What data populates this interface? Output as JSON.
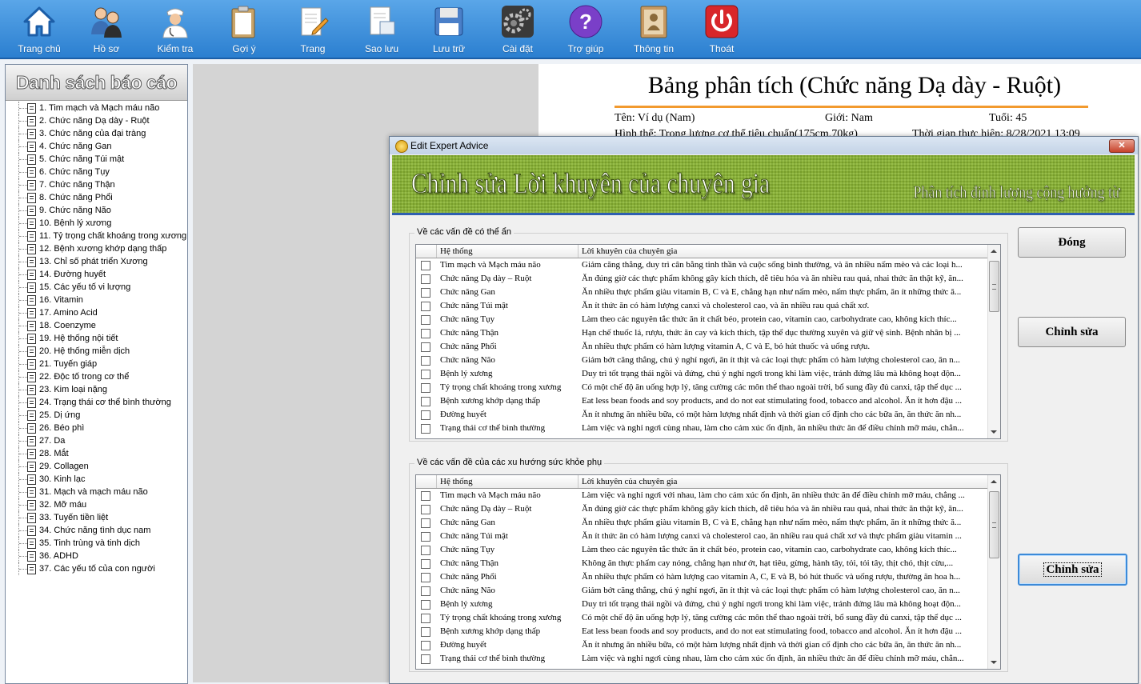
{
  "toolbar": {
    "items": [
      {
        "label": "Trang chủ",
        "icon": "home-icon"
      },
      {
        "label": "Hồ sơ",
        "icon": "users-icon"
      },
      {
        "label": "Kiểm tra",
        "icon": "doctor-icon"
      },
      {
        "label": "Gợi ý",
        "icon": "clipboard-icon"
      },
      {
        "label": "Trang",
        "icon": "page-edit-icon"
      },
      {
        "label": "Sao lưu",
        "icon": "backup-icon"
      },
      {
        "label": "Lưu trữ",
        "icon": "save-disk-icon"
      },
      {
        "label": "Cài đặt",
        "icon": "gear-icon"
      },
      {
        "label": "Trợ giúp",
        "icon": "help-icon"
      },
      {
        "label": "Thông tin",
        "icon": "info-book-icon"
      },
      {
        "label": "Thoát",
        "icon": "power-icon"
      }
    ]
  },
  "left_panel": {
    "title": "Danh sách báo cáo",
    "items": [
      "1. Tim mạch và Mạch máu não",
      "2. Chức năng Dạ dày - Ruột",
      "3. Chức năng của đại tràng",
      "4. Chức năng Gan",
      "5. Chức năng Túi mật",
      "6. Chức năng Tụy",
      "7. Chức năng Thận",
      "8. Chức năng Phổi",
      "9. Chức năng Não",
      "10. Bệnh lý xương",
      "11. Tỷ trọng chất khoáng trong xương",
      "12. Bệnh xương khớp dạng thấp",
      "13. Chỉ số phát triển Xương",
      "14. Đường huyết",
      "15. Các yếu tố vi lượng",
      "16. Vitamin",
      "17. Amino Acid",
      "18. Coenzyme",
      "19. Hệ thống nội tiết",
      "20. Hệ thống miễn dịch",
      "21. Tuyến giáp",
      "22. Độc tố trong cơ thể",
      "23. Kim loại nặng",
      "24. Trạng thái cơ thể bình thường",
      "25. Dị ứng",
      "26. Béo phì",
      "27. Da",
      "28. Mắt",
      "29. Collagen",
      "30. Kinh lạc",
      "31. Mạch và mạch máu não",
      "32. Mỡ máu",
      "33. Tuyến tiền liệt",
      "34. Chức năng tình dục nam",
      "35. Tinh trùng và tinh dịch",
      "36. ADHD",
      "37. Các yếu tố của con người"
    ]
  },
  "report": {
    "title": "Bảng phân tích (Chức năng Dạ dày - Ruột)",
    "name": "Tên: Ví dụ (Nam)",
    "gender": "Giới: Nam",
    "age": "Tuổi: 45",
    "physique": "Hình thể: Trọng lượng cơ thể tiêu chuẩn(175cm,70kg)",
    "time": "Thời gian thực hiện: 8/28/2021 13:09"
  },
  "dialog": {
    "title": "Edit Expert Advice",
    "close_label": "✕",
    "banner_title": "Chỉnh sửa Lời khuyên của chuyên gia",
    "banner_subtitle": "Phân tích định lượng cộng hưởng từ",
    "buttons": {
      "close": "Đóng",
      "edit1": "Chỉnh sửa",
      "edit2": "Chỉnh sửa"
    },
    "col_system": "Hệ thống",
    "col_advice": "Lời khuyên của chuyên gia",
    "group1": {
      "label": "Về các vấn đề có thể ẩn",
      "rows": [
        {
          "system": "Tim mạch và Mạch máu não",
          "advice": "Giảm căng thẳng, duy trì cân bằng tinh thần và cuộc sống bình thường, và ăn nhiều nấm mèo và các loại h..."
        },
        {
          "system": "Chức năng Dạ dày – Ruột",
          "advice": "Ăn đúng giờ các thực phẩm không gây kích thích, dễ tiêu hóa và ăn nhiều rau quả, nhai thức ăn thật kỹ, ăn..."
        },
        {
          "system": "Chức năng Gan",
          "advice": "Ăn nhiều thực phẩm giàu vitamin B, C và E, chẳng hạn như nấm mèo, nấm thực phẩm, ăn ít những thức ă..."
        },
        {
          "system": "Chức năng Túi mật",
          "advice": "Ăn ít thức ăn có hàm lượng canxi và cholesterol cao, và ăn nhiều rau quả chất xơ."
        },
        {
          "system": "Chức năng Tụy",
          "advice": "Làm theo các nguyên tắc thức ăn ít chất béo, protein cao, vitamin cao, carbohydrate cao, không kích thíc..."
        },
        {
          "system": "Chức năng Thận",
          "advice": "Hạn chế thuốc lá, rượu, thức ăn cay và kích thích, tập thể dục thường xuyên và giữ vệ sinh. Bệnh nhân bị ..."
        },
        {
          "system": "Chức năng Phổi",
          "advice": "Ăn nhiều thực phẩm có hàm lượng vitamin A, C và E, bỏ hút thuốc và uống rượu."
        },
        {
          "system": "Chức năng Não",
          "advice": "Giảm bớt căng thẳng, chú ý nghỉ ngơi, ăn ít thịt và các loại thực phẩm có hàm lượng cholesterol cao, ăn n..."
        },
        {
          "system": "Bệnh lý xương",
          "advice": "Duy trì tốt trạng thái ngồi và đứng, chú ý nghỉ ngơi trong khi làm việc, tránh đứng lâu mà không hoạt độn..."
        },
        {
          "system": "Tỷ trọng chất khoáng trong xương",
          "advice": "Có một chế độ ăn uống hợp lý, tăng cường các môn thể thao ngoài trời, bổ sung đầy đủ canxi, tập thể dục ..."
        },
        {
          "system": "Bệnh xương khớp dạng thấp",
          "advice": "Eat less bean foods and soy products, and do not eat stimulating food, tobacco and alcohol. Ăn ít hơn đậu ..."
        },
        {
          "system": "Đường huyết",
          "advice": "Ăn ít nhưng ăn nhiều bữa, có một hàm lượng nhất định và thời gian cố định cho các bữa ăn, ăn thức ăn nh..."
        },
        {
          "system": "Trạng thái cơ thể bình thường",
          "advice": "Làm việc và nghỉ ngơi cùng nhau, làm cho cảm xúc ổn định, ăn nhiều thức ăn để điều chỉnh mỡ máu, chẳn..."
        }
      ]
    },
    "group2": {
      "label": "Về các vấn đề của các xu hướng sức khỏe phụ",
      "rows": [
        {
          "system": "Tim mạch và Mạch máu não",
          "advice": "Làm việc và nghỉ ngơi với nhau, làm cho cảm xúc ổn định, ăn nhiều thức ăn để điều chỉnh mỡ máu, chẳng ..."
        },
        {
          "system": "Chức năng Dạ dày – Ruột",
          "advice": "Ăn đúng giờ các thực phẩm không gây kích thích, dễ tiêu hóa và ăn nhiều rau quả, nhai thức ăn thật kỹ, ăn..."
        },
        {
          "system": "Chức năng Gan",
          "advice": "Ăn nhiều thực phẩm giàu vitamin B, C và E, chẳng hạn như nấm mèo, nấm thực phẩm, ăn ít những thức ă..."
        },
        {
          "system": "Chức năng Túi mật",
          "advice": "Ăn ít thức ăn có hàm lượng canxi và cholesterol cao, ăn nhiều rau quả chất xơ và thực phẩm giàu vitamin ..."
        },
        {
          "system": "Chức năng Tụy",
          "advice": "Làm theo các nguyên tắc thức ăn ít chất béo, protein cao, vitamin cao, carbohydrate cao, không kích thíc..."
        },
        {
          "system": "Chức năng Thận",
          "advice": "Không ăn thực phẩm cay nóng, chẳng hạn như ớt, hạt tiêu, gừng, hành tây, tỏi, tỏi tây, thịt chó, thịt cừu,..."
        },
        {
          "system": "Chức năng Phổi",
          "advice": "Ăn nhiều thực phẩm có hàm lượng cao vitamin A, C, E và B, bỏ hút thuốc và uống rượu, thường ăn hoa h..."
        },
        {
          "system": "Chức năng Não",
          "advice": "Giảm bớt căng thẳng, chú ý nghỉ ngơi, ăn ít thịt và các loại thực phẩm có hàm lượng cholesterol cao, ăn n..."
        },
        {
          "system": "Bệnh lý xương",
          "advice": "Duy trì tốt trạng thái ngồi và đứng, chú ý nghỉ ngơi trong khi làm việc, tránh đứng lâu mà không hoạt độn..."
        },
        {
          "system": "Tỷ trọng chất khoáng trong xương",
          "advice": "Có một chế độ ăn uống hợp lý, tăng cường các môn thể thao ngoài trời, bổ sung đầy đủ canxi, tập thể dục ..."
        },
        {
          "system": "Bệnh xương khớp dạng thấp",
          "advice": "Eat less bean foods and soy products, and do not eat stimulating food, tobacco and alcohol. Ăn ít hơn đậu ..."
        },
        {
          "system": "Đường huyết",
          "advice": "Ăn ít nhưng ăn nhiều bữa, có một hàm lượng nhất định và thời gian cố định cho các bữa ăn, ăn thức ăn nh..."
        },
        {
          "system": "Trạng thái cơ thể bình thường",
          "advice": "Làm việc và nghỉ ngơi cùng nhau, làm cho cảm xúc ổn định, ăn nhiều thức ăn để điều chỉnh mỡ máu, chẳn..."
        }
      ]
    }
  }
}
